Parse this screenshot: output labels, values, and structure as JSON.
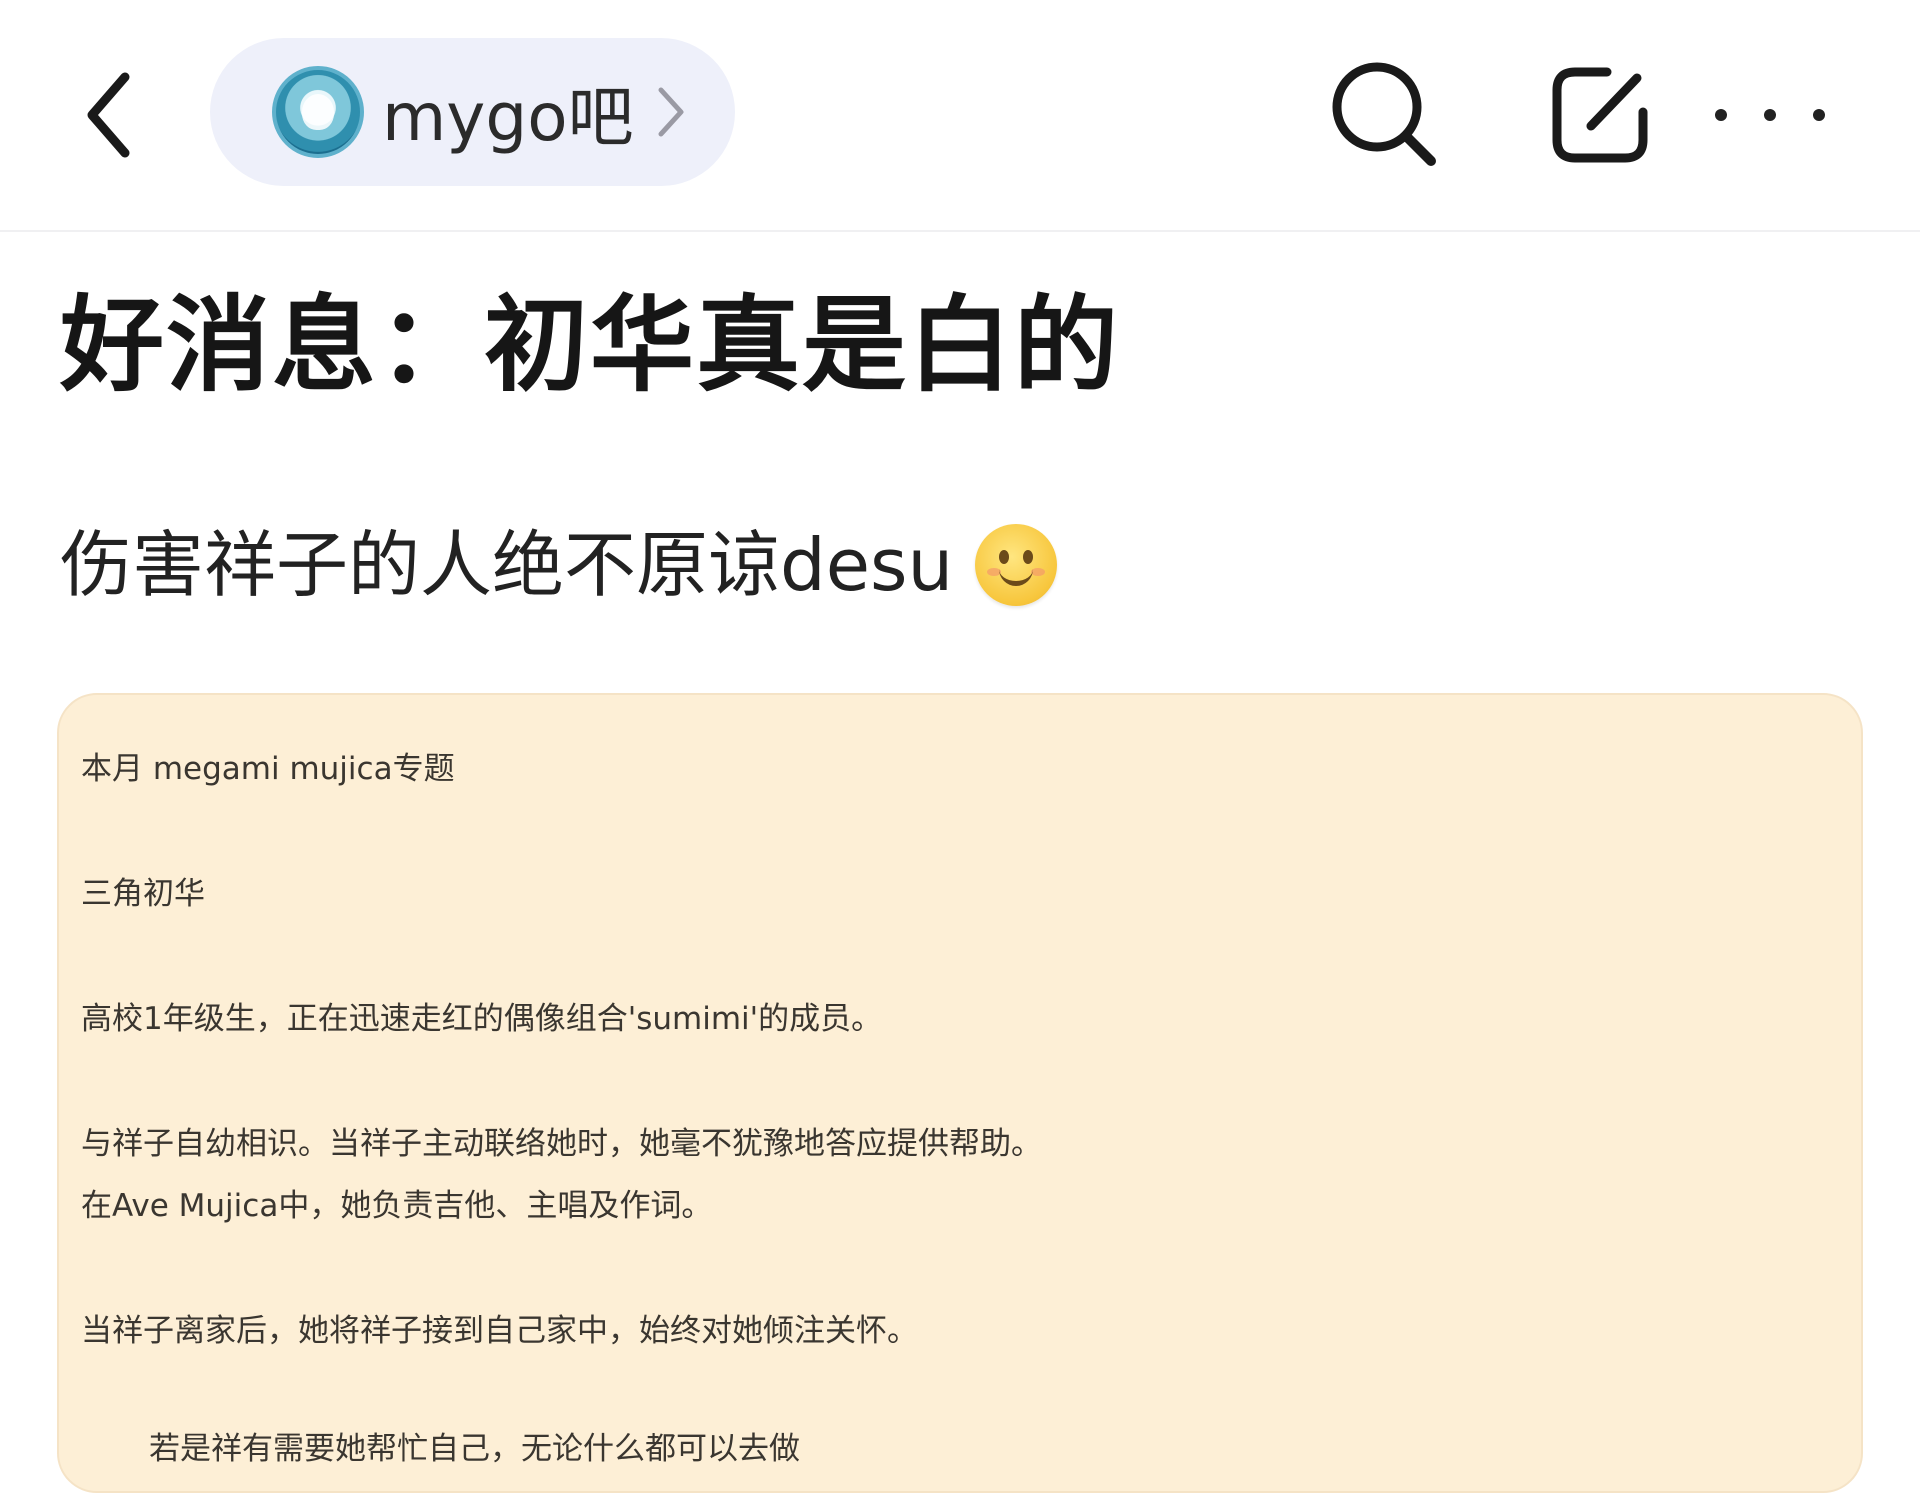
{
  "header": {
    "forum_name": "mygo吧",
    "icons": {
      "back": "back-chevron-icon",
      "forum_avatar": "forum-avatar",
      "forum_chevron": "chevron-right-icon",
      "search": "search-icon",
      "compose": "compose-icon",
      "more": "more-icon"
    }
  },
  "post": {
    "title": "好消息：初华真是白的",
    "body_text": "伤害祥子的人绝不原谅desu",
    "body_emoji": "smile-emoji"
  },
  "image_text": {
    "lines": [
      "本月 megami mujica专题",
      "三角初华",
      "高校1年级生，正在迅速走红的偶像组合'sumimi'的成员。",
      "与祥子自幼相识。当祥子主动联络她时，她毫不犹豫地答应提供帮助。",
      "在Ave Mujica中，她负责吉他、主唱及作词。",
      "当祥子离家后，她将祥子接到自己家中，始终对她倾注关怀。",
      "若是祥有需要她帮忙自己，无论什么都可以去做"
    ]
  },
  "colors": {
    "pill_bg": "#eef0fa",
    "card_bg": "#fdefd6",
    "text_dark": "#161616"
  }
}
